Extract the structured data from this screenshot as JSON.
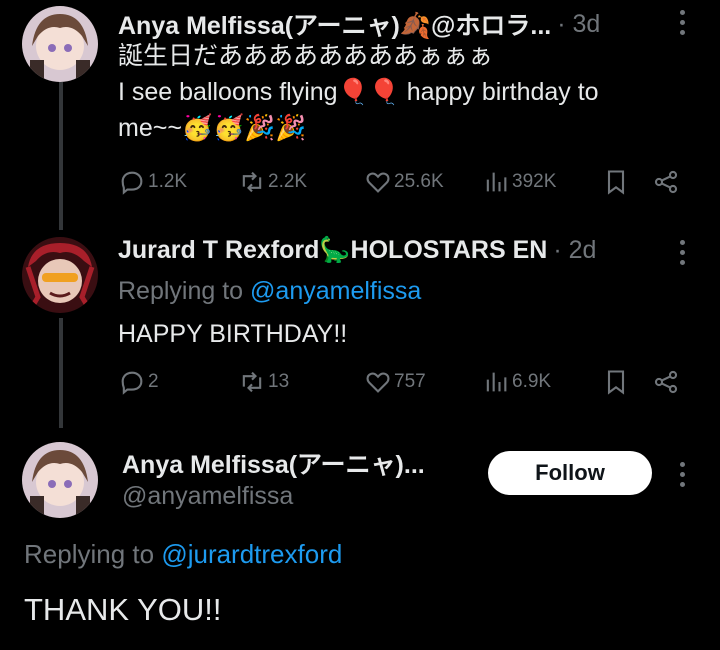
{
  "tweets": [
    {
      "name": "Anya Melfissa(アーニャ)🍂@ホロラ...",
      "time": "· 3d",
      "text_line1": "誕生日だああああああああぁぁぁ",
      "text_line2": "I see balloons flying🎈🎈 happy birthday to",
      "text_line3": "me~~🥳🥳🎉🎉",
      "stats": {
        "replies": "1.2K",
        "reposts": "2.2K",
        "likes": "25.6K",
        "views": "392K"
      }
    },
    {
      "name": "Jurard T Rexford🦕HOLOSTARS EN",
      "time": "· 2d",
      "replying_prefix": "Replying to ",
      "replying_handle": "@anyamelfissa",
      "text": "HAPPY BIRTHDAY!!",
      "stats": {
        "replies": "2",
        "reposts": "13",
        "likes": "757",
        "views": "6.9K"
      }
    }
  ],
  "focused": {
    "name": "Anya Melfissa(アーニャ)...",
    "handle": "@anyamelfissa",
    "follow_label": "Follow",
    "replying_prefix": "Replying to ",
    "replying_handle": "@jurardtrexford",
    "text": "THANK YOU!!"
  },
  "colors": {
    "background": "#000000",
    "text": "#e7e9ea",
    "muted": "#71767b",
    "link": "#1d9bf0",
    "follow_bg": "#ffffff"
  },
  "icons": [
    "reply-icon",
    "repost-icon",
    "like-icon",
    "views-icon",
    "bookmark-icon",
    "share-icon",
    "more-icon"
  ]
}
